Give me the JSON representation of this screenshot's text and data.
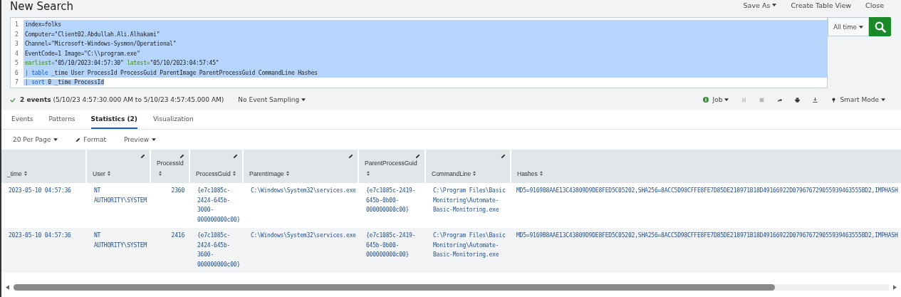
{
  "header": {
    "title": "New Search",
    "actions": [
      {
        "label": "Save As",
        "dropdown": true
      },
      {
        "label": "Create Table View",
        "dropdown": false
      },
      {
        "label": "Close",
        "dropdown": false
      }
    ]
  },
  "query": {
    "lines": [
      {
        "number": "1",
        "selected": true,
        "selected_to_line_end": true,
        "segments": [
          {
            "text": "index=folks",
            "kind": "plain"
          }
        ]
      },
      {
        "number": "2",
        "selected": true,
        "selected_to_line_end": true,
        "segments": [
          {
            "text": "Computer=\"Client02.Abdullah.Ali.Alhakami\"",
            "kind": "plain"
          }
        ]
      },
      {
        "number": "3",
        "selected": true,
        "selected_to_line_end": true,
        "segments": [
          {
            "text": "Channel=\"Microsoft-Windows-Sysmon/Operational\"",
            "kind": "plain"
          }
        ]
      },
      {
        "number": "4",
        "selected": true,
        "selected_to_line_end": true,
        "segments": [
          {
            "text": "EventCode=1 Image=\"C:\\\\program.exe\"",
            "kind": "plain"
          }
        ]
      },
      {
        "number": "5",
        "selected": true,
        "selected_to_line_end": true,
        "segments": [
          {
            "text": "earliest=",
            "kind": "modifier"
          },
          {
            "text": "\"05/10/2023:04:57:30\" ",
            "kind": "plain"
          },
          {
            "text": "latest=",
            "kind": "modifier"
          },
          {
            "text": "\"05/10/2023:04:57:45\"",
            "kind": "plain"
          }
        ]
      },
      {
        "number": "6",
        "selected": true,
        "selected_to_line_end": true,
        "segments": [
          {
            "text": "| ",
            "kind": "pipe"
          },
          {
            "text": "table",
            "kind": "command"
          },
          {
            "text": " _time User ProcessId ProcessGuid ParentImage ParentProcessGuid CommandLine Hashes",
            "kind": "plain"
          }
        ]
      },
      {
        "number": "7",
        "selected": true,
        "selected_to_line_end": false,
        "segments": [
          {
            "text": "| ",
            "kind": "pipe"
          },
          {
            "text": "sort",
            "kind": "command"
          },
          {
            "text": " 0 _time ProcessId",
            "kind": "plain"
          }
        ]
      }
    ],
    "time_range": "All time"
  },
  "status": {
    "summary": "**2 events** (5/10/23 4:57:30.000 AM to 5/10/23 4:57:45.000 AM)",
    "sampling": "No Event Sampling",
    "job": "Job",
    "mode": "Smart Mode",
    "job_controls": [
      {
        "kind": "pause",
        "disabled": true
      },
      {
        "kind": "stop",
        "disabled": true
      },
      {
        "kind": "share",
        "disabled": false
      },
      {
        "kind": "print",
        "disabled": false
      },
      {
        "kind": "export",
        "disabled": false
      }
    ]
  },
  "tabs": [
    {
      "label": "Events",
      "selected": false
    },
    {
      "label": "Patterns",
      "selected": false
    },
    {
      "label": "Statistics (2)",
      "selected": true
    },
    {
      "label": "Visualization",
      "selected": false
    }
  ],
  "toolbar": [
    {
      "label": "20 Per Page",
      "kind": "dropdown"
    },
    {
      "label": "Format",
      "kind": "edit"
    },
    {
      "label": "Preview",
      "kind": "dropdown"
    }
  ],
  "table": {
    "columns": [
      {
        "label": "_time",
        "editable": false,
        "numeric": false
      },
      {
        "label": "User",
        "editable": true,
        "numeric": false
      },
      {
        "label": "ProcessId",
        "editable": true,
        "numeric": true
      },
      {
        "label": "ProcessGuid",
        "editable": true,
        "numeric": false
      },
      {
        "label": "ParentImage",
        "editable": true,
        "numeric": false
      },
      {
        "label": "ParentProcessGuid",
        "editable": true,
        "numeric": false
      },
      {
        "label": "CommandLine",
        "editable": true,
        "numeric": false
      },
      {
        "label": "Hashes",
        "editable": false,
        "numeric": false
      }
    ],
    "rows": [
      {
        "cells": [
          "2023-05-10 04:57:36",
          "NT AUTHORITY\\SYSTEM",
          "2360",
          "{e7c1085c-2424-645b-3000-000000000c00}",
          "C:\\Windows\\System32\\services.exe",
          "{e7c1085c-2419-645b-0b00-000000000c00}",
          "C:\\Program Files\\Basic Monitoring\\Automate-Basic-Monitoring.exe",
          "MD5=9169B8AAE13C43809D9DE8FED5C05202,SHA256=8ACC5D98CFFE8FE7D85DE218971B18D49166922D079676729055939463555BD2,IMPHASH"
        ]
      },
      {
        "cells": [
          "2023-05-10 04:57:36",
          "NT AUTHORITY\\SYSTEM",
          "2416",
          "{e7c1085c-2424-645b-3600-000000000c00}",
          "C:\\Windows\\System32\\services.exe",
          "{e7c1085c-2419-645b-0b00-000000000c00}",
          "C:\\Program Files\\Basic Monitoring\\Automate-Basic-Monitoring.exe",
          "MD5=9169B8AAE13C43809D9DE8FED5C05202,SHA256=8ACC5D98CFFE8FE7D85DE218971B18D49166922D079676729055939463555BD2,IMPHASH"
        ]
      }
    ]
  }
}
